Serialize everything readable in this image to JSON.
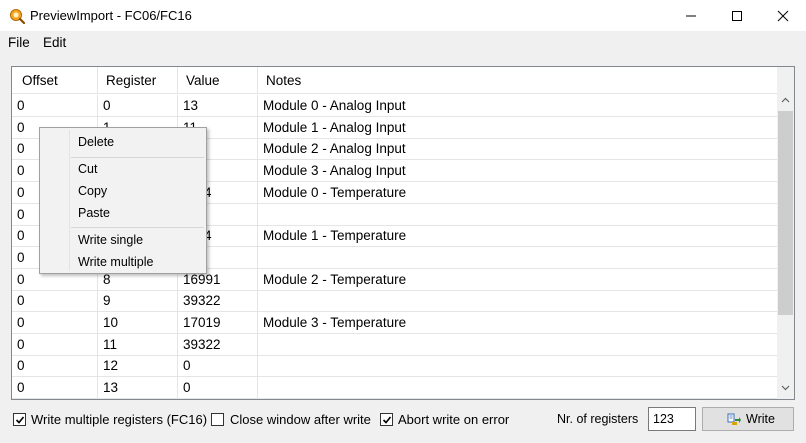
{
  "window": {
    "title": "PreviewImport - FC06/FC16"
  },
  "menu": [
    "File",
    "Edit"
  ],
  "grid": {
    "columns": [
      "Offset",
      "Register",
      "Value",
      "Notes"
    ],
    "rows": [
      [
        "0",
        "0",
        "13",
        "Module 0 - Analog Input"
      ],
      [
        "0",
        "1",
        "11",
        "Module 1 - Analog Input"
      ],
      [
        "0",
        "",
        "",
        "Module 2 - Analog Input"
      ],
      [
        "0",
        "",
        "",
        "Module 3 - Analog Input"
      ],
      [
        "0",
        "",
        "…34",
        "Module 0 - Temperature"
      ],
      [
        "0",
        "",
        "…4",
        ""
      ],
      [
        "0",
        "",
        "…34",
        "Module 1 - Temperature"
      ],
      [
        "0",
        "",
        "…4",
        ""
      ],
      [
        "0",
        "8",
        "16991",
        "Module 2 - Temperature"
      ],
      [
        "0",
        "9",
        "39322",
        ""
      ],
      [
        "0",
        "10",
        "17019",
        "Module 3 - Temperature"
      ],
      [
        "0",
        "11",
        "39322",
        ""
      ],
      [
        "0",
        "12",
        "0",
        ""
      ],
      [
        "0",
        "13",
        "0",
        ""
      ]
    ]
  },
  "context_menu": [
    "Delete",
    "Cut",
    "Copy",
    "Paste",
    "Write single",
    "Write multiple"
  ],
  "options": {
    "write_multiple": {
      "label": "Write multiple registers (FC16)",
      "checked": true
    },
    "close_after_write": {
      "label": "Close window after write",
      "checked": false
    },
    "abort_on_error": {
      "label": "Abort write on error",
      "checked": true
    }
  },
  "nr_registers": {
    "label": "Nr. of registers",
    "value": "123"
  },
  "write_button": {
    "label": "Write"
  },
  "colors": {
    "border": "#828790",
    "grid_line": "#e5e5e5",
    "window_bg": "#f0f0f0"
  }
}
